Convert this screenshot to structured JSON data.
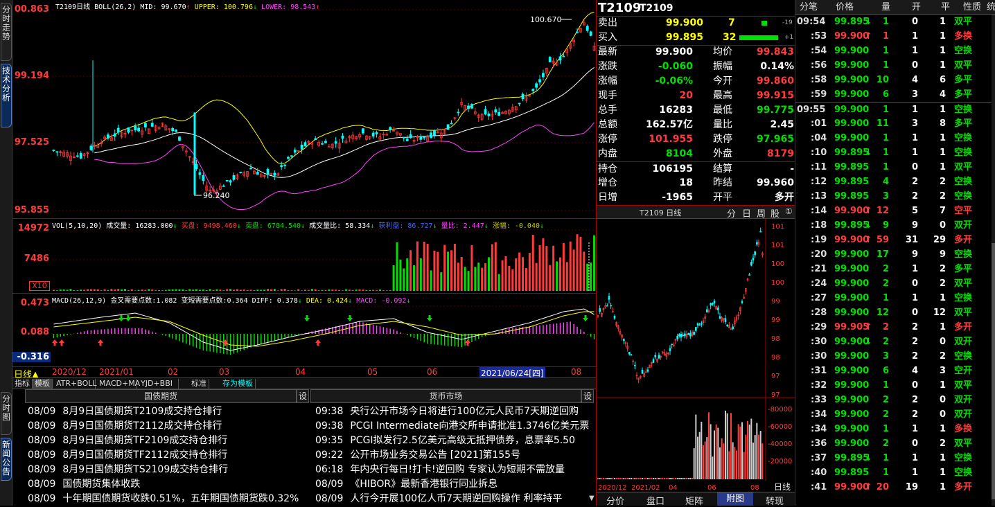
{
  "left_tabs": [
    "分时走势",
    "技术分析"
  ],
  "main_chart": {
    "title": "T2109日线",
    "indicator": "BOLL(26,2)",
    "mid": "MID: 99.670",
    "upper": "UPPER: 100.796",
    "lower": "LOWER: 98.543",
    "price_axis": [
      "00.863",
      "99.194",
      "97.525",
      "95.855"
    ],
    "high_label": "100.670",
    "low_label": "96.240",
    "colors": {
      "up": "#ff3b3b",
      "down": "#00ffff",
      "upper": "#ffff00",
      "mid": "#ffffff",
      "lower": "#ff44ff"
    }
  },
  "vol_panel": {
    "title": "VOL(5,10,20)",
    "vol_label": "成交量: 16283.000",
    "buy_label": "买盘: 9498.460",
    "sell_label": "卖盘: 6784.540",
    "ratio_label": "成交量比: 58.334",
    "oi_label": "获利盘: 86.727",
    "liangbi_label": "量比: 2.447",
    "zhangfu_label": "涨幅: -0.040",
    "axis": [
      "14972",
      "7486"
    ],
    "unit": "X10"
  },
  "macd_panel": {
    "title": "MACD(26,12,9)",
    "gold_label": "金叉需要点数:1.082",
    "trend_label": "变短需要点数:0.364",
    "diff": "DIFF: 0.378",
    "dea": "DEA: 0.424",
    "macd": "MACD: -0.092",
    "axis": [
      "0.473",
      "0.088",
      "-0.316"
    ]
  },
  "date_bar": {
    "labels": [
      "2020/12",
      "2021/01",
      "02",
      "03",
      "04",
      "05",
      "06",
      "08"
    ],
    "cursor": "2021/06/24[四]",
    "period": "日线▲"
  },
  "template_bar": {
    "items": [
      "指标",
      "模板",
      "ATR+BOLL",
      "MACD+MA",
      "YJD+BBI",
      "标准",
      "存为模板"
    ]
  },
  "bottom_tabs": [
    "分时图",
    "新闻公告"
  ],
  "news_left": {
    "header": "国债期货",
    "settings": "设",
    "items": [
      {
        "date": "08/09",
        "text": "8月9日国债期货T2109成交持仓排行"
      },
      {
        "date": "08/09",
        "text": "8月9日国债期货T2112成交持仓排行"
      },
      {
        "date": "08/09",
        "text": "8月9日国债期货TF2109成交持仓排行"
      },
      {
        "date": "08/09",
        "text": "8月9日国债期货TF2112成交持仓排行"
      },
      {
        "date": "08/09",
        "text": "8月9日国债期货TS2109成交持仓排行"
      },
      {
        "date": "08/09",
        "text": "国债期货集体收跌"
      },
      {
        "date": "08/09",
        "text": "十年期国债期货收跌0.51%，五年期国债期货跌0.32%"
      }
    ]
  },
  "news_right": {
    "header": "货币市场",
    "settings": "设",
    "items": [
      {
        "date": "09:38",
        "text": "央行公开市场今日将进行100亿元人民币7天期逆回购"
      },
      {
        "date": "09:38",
        "text": "PCGI Intermediate向港交所申请批准1.3746亿美元票"
      },
      {
        "date": "09:35",
        "text": "PCGI拟发行2.5亿美元高级无抵押债券，息票率5.50"
      },
      {
        "date": "09:22",
        "text": "公开市场业务交易公告 [2021]第155号"
      },
      {
        "date": "06:18",
        "text": "年内央行每日!打卡!逆回购 专家认为短期不需放量"
      },
      {
        "date": "08/09",
        "text": "《HIBOR》最新香港银行同业拆息"
      },
      {
        "date": "08/09",
        "text": "人行今开展100亿人币7天期逆回购操作 利率持平"
      }
    ]
  },
  "quote": {
    "code": "T2109",
    "name": "T2109",
    "sell": {
      "label": "卖出",
      "price": "99.900",
      "vol": "7",
      "chg": "-19"
    },
    "buy": {
      "label": "买入",
      "price": "99.895",
      "vol": "32",
      "chg": "+1"
    },
    "rows": [
      {
        "l1": "最新",
        "v1": "99.900",
        "l2": "均价",
        "v2": "99.843"
      },
      {
        "l1": "涨跌",
        "v1": "-0.060",
        "l2": "振幅",
        "v2": "0.14%"
      },
      {
        "l1": "涨幅",
        "v1": "-0.06%",
        "l2": "今开",
        "v2": "99.860"
      },
      {
        "l1": "现手",
        "v1": "20",
        "l2": "最高",
        "v2": "99.915"
      },
      {
        "l1": "总手",
        "v1": "16283",
        "l2": "最低",
        "v2": "99.775"
      },
      {
        "l1": "总额",
        "v1": "162.57亿",
        "l2": "量比",
        "v2": "2.45"
      },
      {
        "l1": "涨停",
        "v1": "101.955",
        "l2": "跌停",
        "v2": "97.965"
      },
      {
        "l1": "内盘",
        "v1": "8104",
        "l2": "外盘",
        "v2": "8179"
      },
      {
        "l1": "持仓",
        "v1": "106195",
        "l2": "结算",
        "v2": "-"
      },
      {
        "l1": "增仓",
        "v1": "18",
        "l2": "昨结",
        "v2": "99.960"
      },
      {
        "l1": "日增",
        "v1": "-1965",
        "l2": "开平",
        "v2": "多开"
      }
    ]
  },
  "mini_chart": {
    "title": "T2109 日线",
    "buttons": [
      "分",
      "日",
      "周",
      "股",
      "①"
    ],
    "price_axis": [
      "101",
      "101",
      "100",
      "100",
      "99",
      "99",
      "98",
      "98",
      "97",
      "97"
    ],
    "vol_axis": [
      "80000",
      "60000",
      "40000",
      "20000"
    ],
    "date_axis": [
      "2020/12",
      "2021/02",
      "04",
      "06",
      "08"
    ],
    "period": "日线",
    "tabs": [
      "分价",
      "盘口",
      "矩阵",
      "附图",
      "转现"
    ]
  },
  "tick": {
    "headers": [
      "分笔",
      "价格",
      "量",
      "开",
      "平",
      "性质",
      "统"
    ],
    "rows": [
      {
        "t": "09:54",
        "p": "99.895",
        "a": "down",
        "v": "1",
        "o": "0",
        "c": "1",
        "n": "双平",
        "nc": "green"
      },
      {
        "t": ":53",
        "p": "99.900",
        "a": "up",
        "v": "1",
        "o": "1",
        "c": "1",
        "n": "多换",
        "nc": "red"
      },
      {
        "t": ":54",
        "p": "99.900",
        "a": "",
        "v": "1",
        "o": "1",
        "c": "1",
        "n": "空换",
        "nc": "green"
      },
      {
        "t": ":56",
        "p": "99.900",
        "a": "",
        "v": "1",
        "o": "0",
        "c": "1",
        "n": "双平",
        "nc": "green"
      },
      {
        "t": ":58",
        "p": "99.900",
        "a": "",
        "v": "10",
        "o": "4",
        "c": "6",
        "n": "多平",
        "nc": "green"
      },
      {
        "t": ":59",
        "p": "99.900",
        "a": "",
        "v": "6",
        "o": "3",
        "c": "4",
        "n": "多平",
        "nc": "green"
      },
      {
        "t": "09:55",
        "p": "99.900",
        "a": "",
        "v": "1",
        "o": "1",
        "c": "1",
        "n": "空换",
        "nc": "green"
      },
      {
        "t": ":01",
        "p": "99.900",
        "a": "",
        "v": "11",
        "o": "3",
        "c": "8",
        "n": "多平",
        "nc": "green"
      },
      {
        "t": ":04",
        "p": "99.900",
        "a": "",
        "v": "1",
        "o": "1",
        "c": "1",
        "n": "空换",
        "nc": "green"
      },
      {
        "t": ":10",
        "p": "99.895",
        "a": "down",
        "v": "1",
        "o": "1",
        "c": "1",
        "n": "空换",
        "nc": "green"
      },
      {
        "t": ":11",
        "p": "99.895",
        "a": "",
        "v": "1",
        "o": "0",
        "c": "1",
        "n": "双平",
        "nc": "green"
      },
      {
        "t": ":12",
        "p": "99.895",
        "a": "",
        "v": "4",
        "o": "2",
        "c": "2",
        "n": "空换",
        "nc": "green"
      },
      {
        "t": ":13",
        "p": "99.895",
        "a": "",
        "v": "3",
        "o": "2",
        "c": "2",
        "n": "空换",
        "nc": "green"
      },
      {
        "t": ":14",
        "p": "99.900",
        "a": "up",
        "v": "12",
        "o": "5",
        "c": "7",
        "n": "空平",
        "nc": "red"
      },
      {
        "t": ":18",
        "p": "99.895",
        "a": "down",
        "v": "9",
        "o": "9",
        "c": "0",
        "n": "双开",
        "nc": "green"
      },
      {
        "t": ":19",
        "p": "99.900",
        "a": "up",
        "v": "59",
        "o": "31",
        "c": "29",
        "n": "多开",
        "nc": "red"
      },
      {
        "t": ":20",
        "p": "99.900",
        "a": "",
        "v": "17",
        "o": "9",
        "c": "9",
        "n": "空换",
        "nc": "green"
      },
      {
        "t": ":21",
        "p": "99.900",
        "a": "",
        "v": "2",
        "o": "1",
        "c": "2",
        "n": "多平",
        "nc": "green"
      },
      {
        "t": ":24",
        "p": "99.900",
        "a": "",
        "v": "2",
        "o": "0",
        "c": "2",
        "n": "双平",
        "nc": "green"
      },
      {
        "t": ":27",
        "p": "99.900",
        "a": "",
        "v": "1",
        "o": "1",
        "c": "1",
        "n": "空换",
        "nc": "green"
      },
      {
        "t": ":28",
        "p": "99.900",
        "a": "",
        "v": "12",
        "o": "0",
        "c": "12",
        "n": "双平",
        "nc": "green"
      },
      {
        "t": ":29",
        "p": "99.905",
        "a": "up",
        "v": "2",
        "o": "2",
        "c": "1",
        "n": "多开",
        "nc": "red"
      },
      {
        "t": ":30",
        "p": "99.900",
        "a": "down",
        "v": "2",
        "o": "2",
        "c": "0",
        "n": "双开",
        "nc": "green"
      },
      {
        "t": ":30",
        "p": "99.900",
        "a": "",
        "v": "3",
        "o": "2",
        "c": "2",
        "n": "空换",
        "nc": "green"
      },
      {
        "t": ":31",
        "p": "99.900",
        "a": "",
        "v": "6",
        "o": "4",
        "c": "3",
        "n": "空开",
        "nc": "green"
      },
      {
        "t": ":32",
        "p": "99.900",
        "a": "",
        "v": "1",
        "o": "0",
        "c": "1",
        "n": "双平",
        "nc": "green"
      },
      {
        "t": ":33",
        "p": "99.900",
        "a": "",
        "v": "2",
        "o": "2",
        "c": "0",
        "n": "双开",
        "nc": "green"
      },
      {
        "t": ":34",
        "p": "99.900",
        "a": "",
        "v": "2",
        "o": "2",
        "c": "0",
        "n": "双开",
        "nc": "green"
      },
      {
        "t": ":34",
        "p": "99.900",
        "a": "",
        "v": "1",
        "o": "1",
        "c": "1",
        "n": "多换",
        "nc": "red"
      },
      {
        "t": ":36",
        "p": "99.900",
        "a": "",
        "v": "2",
        "o": "0",
        "c": "2",
        "n": "双平",
        "nc": "green"
      },
      {
        "t": ":37",
        "p": "99.895",
        "a": "down",
        "v": "1",
        "o": "1",
        "c": "1",
        "n": "空换",
        "nc": "green"
      },
      {
        "t": ":40",
        "p": "99.895",
        "a": "",
        "v": "1",
        "o": "1",
        "c": "1",
        "n": "空换",
        "nc": "green"
      },
      {
        "t": ":41",
        "p": "99.900",
        "a": "up",
        "v": "20",
        "o": "19",
        "c": "1",
        "n": "多开",
        "nc": "red"
      }
    ]
  }
}
